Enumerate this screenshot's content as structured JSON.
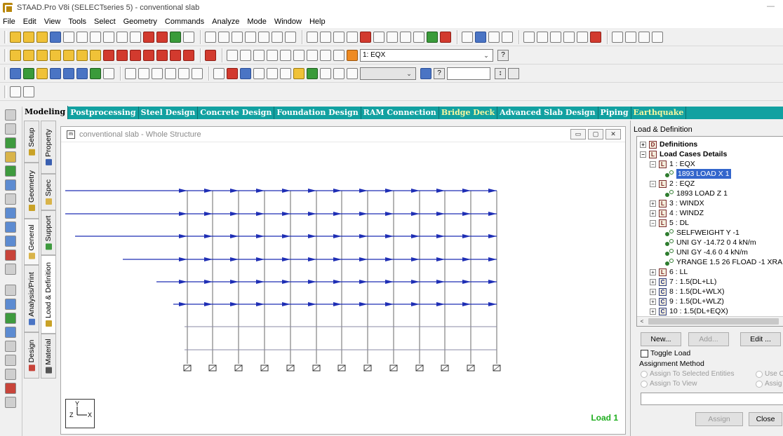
{
  "window": {
    "title": "STAAD.Pro V8i (SELECTseries 5) - conventional slab",
    "minimize_glyph": "—"
  },
  "menu": [
    "File",
    "Edit",
    "View",
    "Tools",
    "Select",
    "Geometry",
    "Commands",
    "Analyze",
    "Mode",
    "Window",
    "Help"
  ],
  "toolbar": {
    "load_case_selected": "1: EQX",
    "help_glyph": "?",
    "increment_glyph": "↕"
  },
  "page_tabs": [
    "Modeling",
    "Postprocessing",
    "Steel Design",
    "Concrete Design",
    "Foundation Design",
    "RAM Connection",
    "Bridge Deck",
    "Advanced Slab Design",
    "Piping",
    "Earthquake"
  ],
  "active_tab": "Modeling",
  "vertical_tabs_outer": [
    "Setup",
    "Geometry",
    "General",
    "Analysis/Print",
    "Design"
  ],
  "vertical_tabs_inner": [
    "Property",
    "Spec",
    "Support",
    "Load & Definition",
    "Material"
  ],
  "view_window": {
    "title": "conventional slab - Whole Structure",
    "load_label": "Load 1",
    "axes": {
      "y": "Y",
      "z": "Z",
      "x": "X"
    }
  },
  "panel": {
    "title": "Load & Definition",
    "tree": [
      {
        "label": "Definitions",
        "icon": "D",
        "expander": "+",
        "bold": true,
        "level": 0
      },
      {
        "label": "Load Cases Details",
        "icon": "L",
        "expander": "-",
        "bold": true,
        "level": 0
      },
      {
        "label": "1 : EQX",
        "icon": "L",
        "expander": "-",
        "level": 1
      },
      {
        "label": "1893 LOAD X 1",
        "icon": "load",
        "level": 2,
        "selected": true
      },
      {
        "label": "2 : EQZ",
        "icon": "L",
        "expander": "-",
        "level": 1
      },
      {
        "label": "1893 LOAD Z 1",
        "icon": "load",
        "level": 2
      },
      {
        "label": "3 : WINDX",
        "icon": "L",
        "expander": "+",
        "level": 1
      },
      {
        "label": "4 : WINDZ",
        "icon": "L",
        "expander": "+",
        "level": 1
      },
      {
        "label": "5 : DL",
        "icon": "L",
        "expander": "-",
        "level": 1
      },
      {
        "label": "SELFWEIGHT Y -1",
        "icon": "load",
        "level": 2
      },
      {
        "label": "UNI GY -14.72 0 4 kN/m",
        "icon": "load",
        "level": 2
      },
      {
        "label": "UNI GY -4.6 0 4 kN/m",
        "icon": "load",
        "level": 2
      },
      {
        "label": "YRANGE 1.5 26 FLOAD -1 XRA",
        "icon": "load",
        "level": 2
      },
      {
        "label": "6 : LL",
        "icon": "L",
        "expander": "+",
        "level": 1
      },
      {
        "label": "7 : 1.5(DL+LL)",
        "icon": "C",
        "expander": "+",
        "level": 1
      },
      {
        "label": "8 : 1.5(DL+WLX)",
        "icon": "C",
        "expander": "+",
        "level": 1
      },
      {
        "label": "9 : 1.5(DL+WLZ)",
        "icon": "C",
        "expander": "+",
        "level": 1
      },
      {
        "label": "10 : 1.5(DL+EQX)",
        "icon": "C",
        "expander": "+",
        "level": 1
      }
    ],
    "scroll_left_glyph": "<",
    "buttons": {
      "new": "New...",
      "add": "Add...",
      "edit": "Edit ..."
    },
    "toggle_load": "Toggle Load",
    "assignment_method": "Assignment Method",
    "radios": [
      "Assign To Selected Entities",
      "Assign To View",
      "Use C",
      "Assig"
    ],
    "assign": "Assign",
    "close": "Close"
  },
  "colors": {
    "tab_bar": "#12a1a1",
    "load_arrow": "#1f2fb5",
    "load_label": "#1fae1f",
    "selection": "#3366cc"
  }
}
